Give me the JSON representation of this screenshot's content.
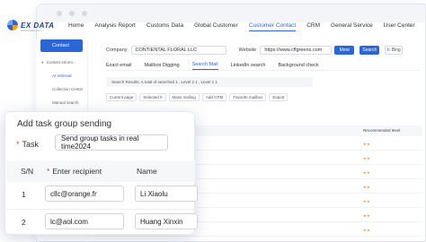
{
  "app": {
    "logo_text": "EX DATA",
    "logo_sub": "www.exdata.com"
  },
  "topnav": {
    "items": [
      {
        "label": "Home"
      },
      {
        "label": "Analysis Report"
      },
      {
        "label": "Customs Data"
      },
      {
        "label": "Global Customer"
      },
      {
        "label": "Customer Contact"
      },
      {
        "label": "CRM"
      },
      {
        "label": "General Service"
      },
      {
        "label": "User Center"
      }
    ],
    "active": "Customer Contact"
  },
  "sidebar": {
    "contact_label": "Contact",
    "items": [
      {
        "label": "Contact inform..."
      },
      {
        "label": "AI retrieval"
      },
      {
        "label": "Collection Center"
      },
      {
        "label": "Manual search"
      }
    ]
  },
  "search": {
    "company_label": "Company",
    "company_value": "CONTIENTAL FLORAL LLC",
    "website_label": "Website",
    "website_value": "https://www.cflgreens.com",
    "more_label": "More",
    "search_label": "Search",
    "bing_label": "Bing"
  },
  "tabs": [
    {
      "label": "Exact email"
    },
    {
      "label": "Mailbox Digging"
    },
    {
      "label": "Search Mail"
    },
    {
      "label": "LinkedIn search"
    },
    {
      "label": "Background check"
    }
  ],
  "active_tab": "Search Mail",
  "results_text": "Search Results: A total of searched 1 , Level 2 1 , Level 1 1",
  "actions": [
    {
      "label": "Current page"
    },
    {
      "label": "Selected 0"
    },
    {
      "label": "Mass mailing"
    },
    {
      "label": "Add CRM"
    },
    {
      "label": "Favorite mailbox"
    },
    {
      "label": "Export"
    }
  ],
  "table": {
    "recommended_header": "Recommended level",
    "rows": [
      {
        "stars": "★★"
      },
      {
        "stars": "★★"
      },
      {
        "stars": "★★"
      },
      {
        "stars": "★★"
      },
      {
        "stars": "★★"
      },
      {
        "stars": "★★"
      },
      {
        "stars": "★★"
      }
    ]
  },
  "dialog": {
    "title": "Add task group sending",
    "task_label": "Task",
    "task_value": "Send group tasks in real time2024",
    "columns": {
      "sn": "S/N",
      "recipient": "Enter recipient",
      "name": "Name"
    },
    "rows": [
      {
        "sn": "1",
        "recipient": "cllc@orange.fr",
        "name": "Li Xiaolu"
      },
      {
        "sn": "2",
        "recipient": "lc@aol.com",
        "name": "Huang Xinxin"
      }
    ]
  },
  "colors": {
    "accent": "#2b66d9",
    "star": "#f08a24",
    "required": "#e23b3b"
  }
}
